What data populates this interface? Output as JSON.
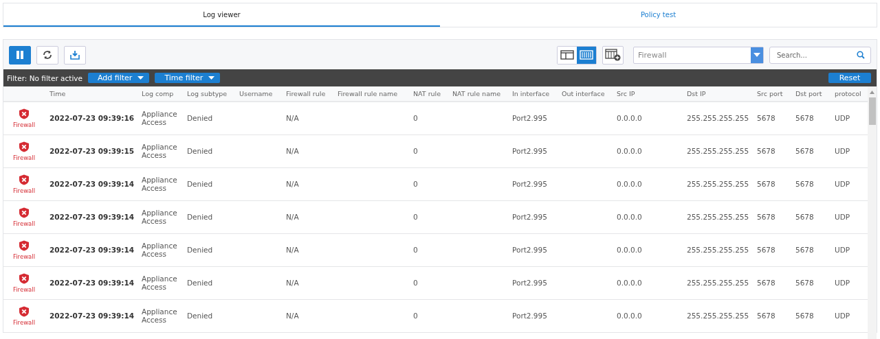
{
  "tabs": [
    {
      "label": "Log viewer",
      "selected": true
    },
    {
      "label": "Policy test",
      "selected": false
    }
  ],
  "toolbar": {
    "paused": true,
    "view_toggle": [
      {
        "kind": "panel",
        "selected": false
      },
      {
        "kind": "grid",
        "selected": true
      }
    ],
    "module_select": {
      "value": "Firewall"
    },
    "search": {
      "placeholder": "Search..."
    }
  },
  "filter_bar": {
    "label": "Filter: No filter active",
    "add_filter": "Add filter",
    "time_filter": "Time filter",
    "reset": "Reset"
  },
  "table": {
    "columns": [
      "",
      "Time",
      "Log comp",
      "Log subtype",
      "Username",
      "Firewall rule",
      "Firewall rule name",
      "NAT rule",
      "NAT rule name",
      "In interface",
      "Out interface",
      "Src IP",
      "Dst IP",
      "Src port",
      "Dst port",
      "protocol"
    ],
    "rows": [
      {
        "cells": [
          "Firewall",
          "2022-07-23 09:39:16",
          "Appliance Access",
          "Denied",
          "",
          "N/A",
          "",
          "0",
          "",
          "Port2.995",
          "",
          "0.0.0.0",
          "255.255.255.255",
          "5678",
          "5678",
          "UDP"
        ]
      },
      {
        "cells": [
          "Firewall",
          "2022-07-23 09:39:15",
          "Appliance Access",
          "Denied",
          "",
          "N/A",
          "",
          "0",
          "",
          "Port2.995",
          "",
          "0.0.0.0",
          "255.255.255.255",
          "5678",
          "5678",
          "UDP"
        ]
      },
      {
        "cells": [
          "Firewall",
          "2022-07-23 09:39:14",
          "Appliance Access",
          "Denied",
          "",
          "N/A",
          "",
          "0",
          "",
          "Port2.995",
          "",
          "0.0.0.0",
          "255.255.255.255",
          "5678",
          "5678",
          "UDP"
        ]
      },
      {
        "cells": [
          "Firewall",
          "2022-07-23 09:39:14",
          "Appliance Access",
          "Denied",
          "",
          "N/A",
          "",
          "0",
          "",
          "Port2.995",
          "",
          "0.0.0.0",
          "255.255.255.255",
          "5678",
          "5678",
          "UDP"
        ]
      },
      {
        "cells": [
          "Firewall",
          "2022-07-23 09:39:14",
          "Appliance Access",
          "Denied",
          "",
          "N/A",
          "",
          "0",
          "",
          "Port2.995",
          "",
          "0.0.0.0",
          "255.255.255.255",
          "5678",
          "5678",
          "UDP"
        ]
      },
      {
        "cells": [
          "Firewall",
          "2022-07-23 09:39:14",
          "Appliance Access",
          "Denied",
          "",
          "N/A",
          "",
          "0",
          "",
          "Port2.995",
          "",
          "0.0.0.0",
          "255.255.255.255",
          "5678",
          "5678",
          "UDP"
        ]
      },
      {
        "cells": [
          "Firewall",
          "2022-07-23 09:39:14",
          "Appliance Access",
          "Denied",
          "",
          "N/A",
          "",
          "0",
          "",
          "Port2.995",
          "",
          "0.0.0.0",
          "255.255.255.255",
          "5678",
          "5678",
          "UDP"
        ]
      }
    ]
  }
}
